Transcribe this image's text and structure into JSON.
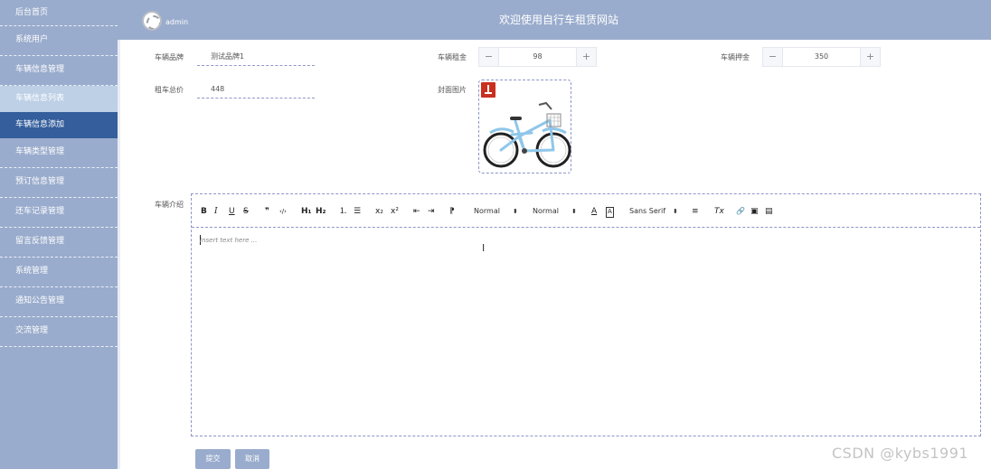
{
  "sidebar": {
    "items": [
      {
        "label": "后台首页"
      },
      {
        "label": "系统用户"
      },
      {
        "label": "车辆信息管理"
      },
      {
        "label": "车辆信息列表"
      },
      {
        "label": "车辆信息添加"
      },
      {
        "label": "车辆类型管理"
      },
      {
        "label": "预订信息管理"
      },
      {
        "label": "还车记录管理"
      },
      {
        "label": "留言反馈管理"
      },
      {
        "label": "系统管理"
      },
      {
        "label": "通知公告管理"
      },
      {
        "label": "交流管理"
      }
    ]
  },
  "header": {
    "user": "admin",
    "title": "欢迎使用自行车租赁网站"
  },
  "form": {
    "brand_label": "车辆品牌",
    "brand_value": "测试品牌1",
    "rent_label": "车辆租金",
    "rent_value": "98",
    "deposit_label": "车辆押金",
    "deposit_value": "350",
    "total_label": "租车总价",
    "total_value": "448",
    "cover_label": "封面图片",
    "intro_label": "车辆介绍",
    "minus": "−",
    "plus": "+"
  },
  "editor": {
    "toolbar": {
      "bold": "B",
      "italic": "I",
      "underline": "U",
      "strike": "S",
      "quote": "❞",
      "code": "‹/›",
      "h1": "H₁",
      "h2": "H₂",
      "ordered": "⒈",
      "bullet": "☰",
      "sub": "x₂",
      "sup": "x²",
      "outdent": "⇤",
      "indent": "⇥",
      "direction": "⁋",
      "size": "Normal",
      "header": "Normal",
      "color": "A",
      "background": "A",
      "font": "Sans Serif",
      "align": "≡",
      "clean": "Tx",
      "link": "🔗",
      "image": "▣",
      "video": "▤",
      "caret": "⬍"
    },
    "placeholder": "Insert text here ..."
  },
  "buttons": {
    "submit": "提交",
    "cancel": "取消"
  },
  "watermark": "CSDN @kybs1991"
}
